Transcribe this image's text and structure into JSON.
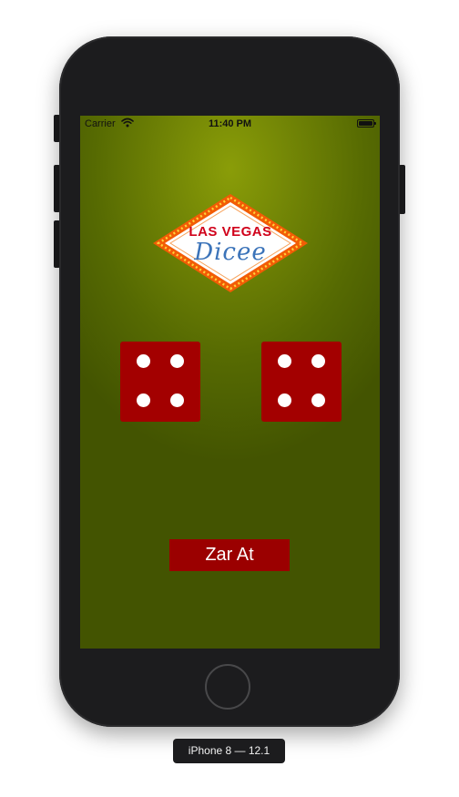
{
  "status_bar": {
    "carrier": "Carrier",
    "wifi_icon": "wifi-icon",
    "time": "11:40 PM",
    "battery_icon": "battery-icon"
  },
  "logo": {
    "line1": "LAS VEGAS",
    "line2": "Dicee"
  },
  "dice": {
    "left": {
      "value": 4,
      "color": "#a30000"
    },
    "right": {
      "value": 4,
      "color": "#a30000"
    }
  },
  "roll_button": {
    "label": "Zar At",
    "color": "#9b0000"
  },
  "simulator": {
    "device_label": "iPhone 8 — 12.1"
  },
  "colors": {
    "felt_center": "#8a9d08",
    "felt_edge": "#435401",
    "device_body": "#1c1c1e"
  }
}
